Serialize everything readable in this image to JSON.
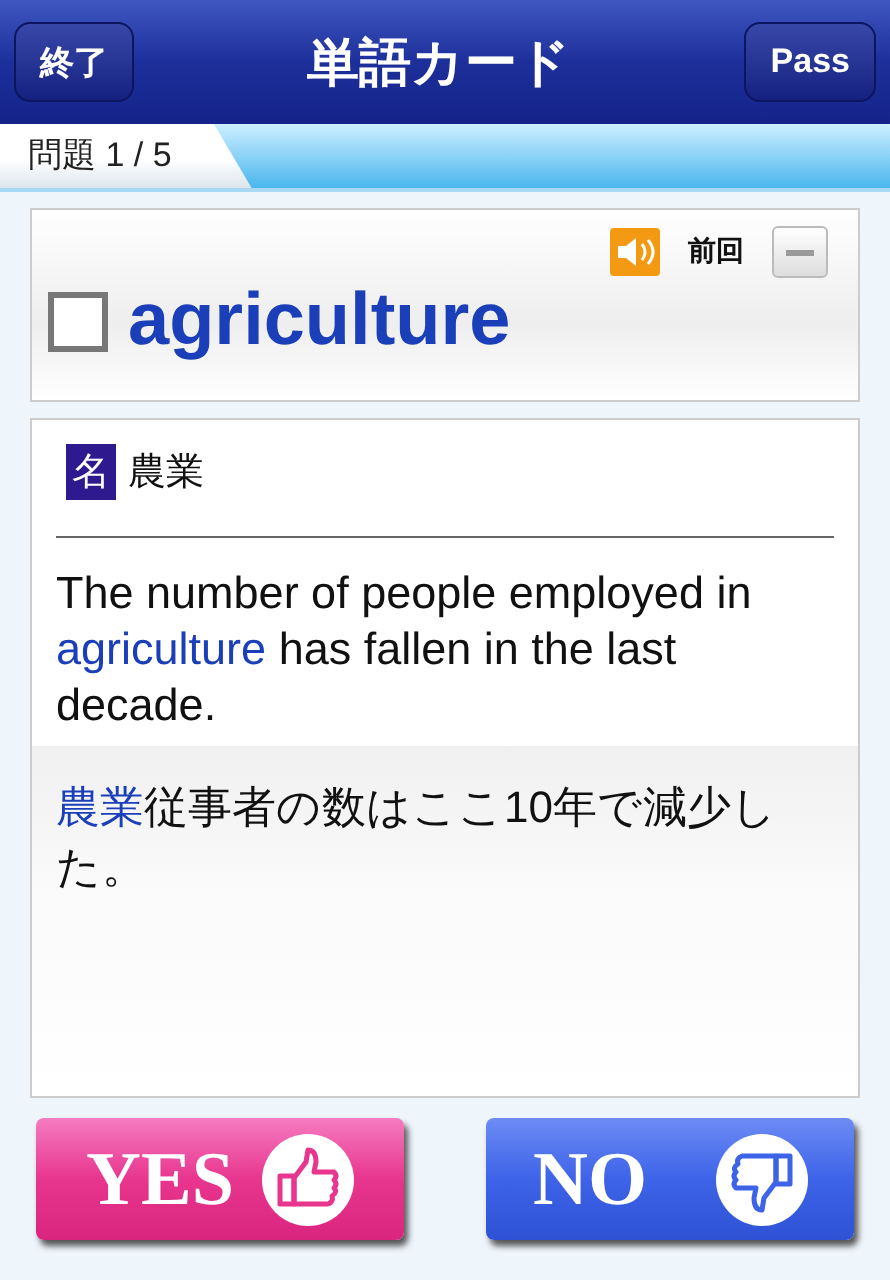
{
  "nav_bar": {
    "left_button": "終了",
    "title": "単語カード",
    "right_button": "Pass"
  },
  "progress": {
    "label": "問題 1 / 5"
  },
  "word_card": {
    "checked": false,
    "word": "agriculture",
    "previous_label": "前回"
  },
  "detail": {
    "part_of_speech": "名",
    "meaning": "農業",
    "example": [
      {
        "text": "The number of people employed in ",
        "highlight": false
      },
      {
        "text": "agriculture",
        "highlight": true
      },
      {
        "text": " has fallen in the last decade.",
        "highlight": false
      }
    ],
    "translation": [
      {
        "text": "農業",
        "highlight": true
      },
      {
        "text": "従事者の数はここ10年で減少した。",
        "highlight": false
      }
    ]
  },
  "answer_buttons": [
    {
      "kind": "yes",
      "label": "YES"
    },
    {
      "kind": "no",
      "label": "NO"
    }
  ]
}
